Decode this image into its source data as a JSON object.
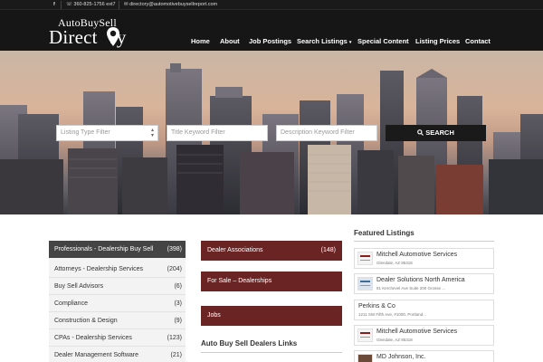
{
  "topbar": {
    "facebook": "f",
    "phone": "360-825-1756 ext7",
    "email": "directory@automotivebuysellreport.com"
  },
  "logo": {
    "line1": "AutoBuySell",
    "line2_part1": "Direct",
    "line2_part2": "ry"
  },
  "nav": [
    {
      "label": "Home"
    },
    {
      "label": "About"
    },
    {
      "label": "Job Postings"
    },
    {
      "label": "Search Listings",
      "caret": "▾"
    },
    {
      "label": "Special Content"
    },
    {
      "label": "Listing Prices"
    },
    {
      "label": "Contact"
    }
  ],
  "search": {
    "type_placeholder": "Listing Type Filter",
    "title_placeholder": "Title Keyword Filter",
    "desc_placeholder": "Description Keyword Filter",
    "button_label": "SEARCH",
    "button_icon": "search-icon"
  },
  "categories": [
    {
      "label": "Professionals - Dealership Buy Sell",
      "count": "(398)"
    },
    {
      "label": "Attorneys - Dealership Services",
      "count": "(204)"
    },
    {
      "label": "Buy Sell Advisors",
      "count": "(6)"
    },
    {
      "label": "Compliance",
      "count": "(3)"
    },
    {
      "label": "Construction & Design",
      "count": "(9)"
    },
    {
      "label": "CPAs - Dealership Services",
      "count": "(123)"
    },
    {
      "label": "Dealer Management Software",
      "count": "(21)"
    }
  ],
  "middle": {
    "boxes": [
      {
        "label": "Dealer Associations",
        "count": "(148)"
      },
      {
        "label": "For Sale – Dealerships",
        "count": ""
      },
      {
        "label": "Jobs",
        "count": ""
      }
    ],
    "links_heading": "Auto Buy Sell Dealers Links"
  },
  "featured": {
    "heading": "Featured Listings",
    "items": [
      {
        "title": "Mitchell Automotive Services",
        "addr": "Glendale, AZ 85318"
      },
      {
        "title": "Dealer Solutions North America",
        "addr": "81 Kerchevel Ave Suite 200 Grosse ..."
      },
      {
        "title": "Perkins & Co",
        "addr": "1211 SW Fifth Ave, #1000, Portland..."
      },
      {
        "title": "Mitchell Automotive Services",
        "addr": "Glendale, AZ 85318"
      },
      {
        "title": "MD Johnson, Inc.",
        "addr": ""
      }
    ]
  },
  "colors": {
    "accent_red": "#6b2424",
    "header_bg": "#161616",
    "active_category": "#444444"
  }
}
